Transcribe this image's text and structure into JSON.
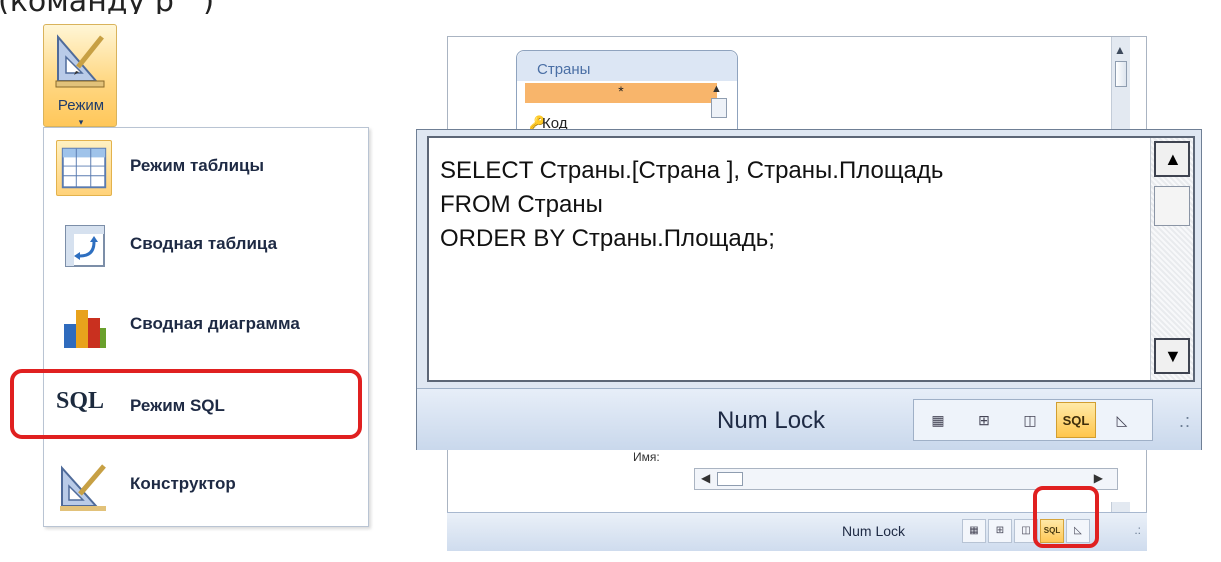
{
  "ribbon": {
    "mode_button_label": "Режим",
    "mode_button_arrow": "▾"
  },
  "menu": {
    "items": [
      {
        "label": "Режим таблицы",
        "icon": "datasheet-view-icon"
      },
      {
        "label": "Сводная таблица",
        "icon": "pivot-table-icon"
      },
      {
        "label": "Сводная диаграмма",
        "icon": "pivot-chart-icon"
      },
      {
        "label": "Режим SQL",
        "icon": "sql-view-icon",
        "icon_text": "SQL"
      },
      {
        "label": "Конструктор",
        "icon": "design-view-icon"
      }
    ],
    "highlight_color": "#e02020"
  },
  "query_design": {
    "table_name": "Страны",
    "star_field": "*",
    "key_field": "Код",
    "lower_label": "Имя:"
  },
  "sql_editor": {
    "lines": [
      "SELECT Страны.[Страна ], Страны.Площадь",
      "FROM Страны",
      "ORDER BY Страны.Площадь;"
    ]
  },
  "status_bar": {
    "num_lock": "Num Lock",
    "sql_button": "SQL",
    "view_buttons": [
      "datasheet-view-icon",
      "pivot-table-icon",
      "pivot-chart-icon",
      "sql-view-icon",
      "design-view-icon"
    ]
  },
  "colors": {
    "accent_orange": "#ffc64d",
    "star_row": "#f8b56b",
    "status_blue": "#c9d8ec"
  }
}
